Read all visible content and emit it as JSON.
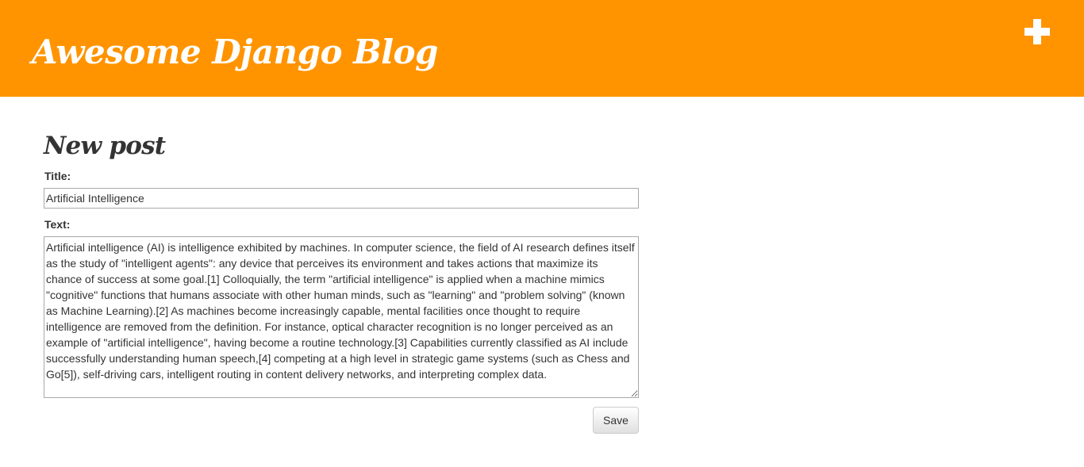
{
  "header": {
    "site_title": "Awesome Django Blog",
    "add_icon": "plus-icon",
    "accent_color": "#ff9400"
  },
  "form": {
    "page_title": "New post",
    "title_label": "Title:",
    "title_value": "Artificial Intelligence",
    "text_label": "Text:",
    "text_value": "Artificial intelligence (AI) is intelligence exhibited by machines. In computer science, the field of AI research defines itself as the study of \"intelligent agents\": any device that perceives its environment and takes actions that maximize its chance of success at some goal.[1] Colloquially, the term \"artificial intelligence\" is applied when a machine mimics \"cognitive\" functions that humans associate with other human minds, such as \"learning\" and \"problem solving\" (known as Machine Learning).[2] As machines become increasingly capable, mental facilities once thought to require intelligence are removed from the definition. For instance, optical character recognition is no longer perceived as an example of \"artificial intelligence\", having become a routine technology.[3] Capabilities currently classified as AI include successfully understanding human speech,[4] competing at a high level in strategic game systems (such as Chess and Go[5]), self-driving cars, intelligent routing in content delivery networks, and interpreting complex data.",
    "save_label": "Save"
  }
}
